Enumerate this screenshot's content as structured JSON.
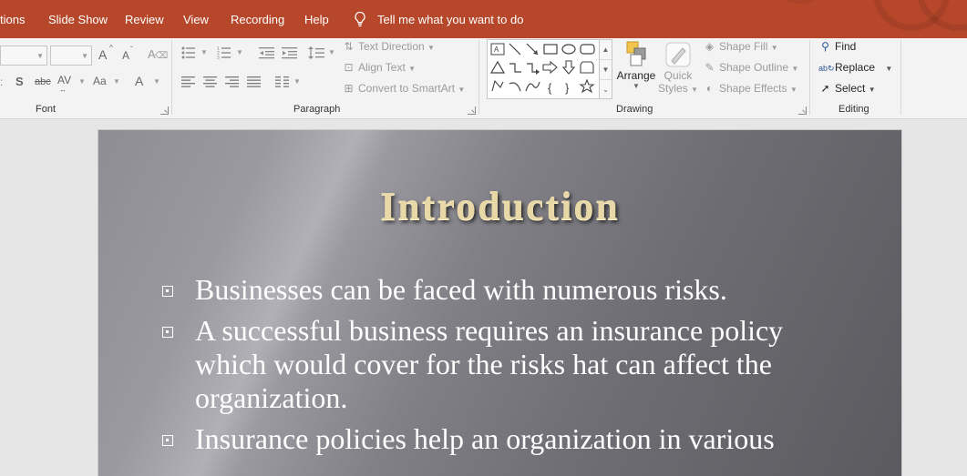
{
  "tabs": [
    {
      "label": "tions"
    },
    {
      "label": "Slide Show"
    },
    {
      "label": "Review"
    },
    {
      "label": "View"
    },
    {
      "label": "Recording"
    },
    {
      "label": "Help"
    }
  ],
  "tell_me": {
    "placeholder": "Tell me what you want to do",
    "icon": "lightbulb-icon"
  },
  "ribbon": {
    "font": {
      "label": "Font",
      "grow_glyph": "A",
      "shrink_glyph": "A",
      "clear_glyph": "A",
      "shadow_glyph": "S",
      "strike_glyph": "abc",
      "spacing_glyph": "AV",
      "case_glyph": "Aa",
      "color_glyph": "A"
    },
    "paragraph": {
      "label": "Paragraph",
      "text_direction": "Text Direction",
      "align_text": "Align Text",
      "convert_smartart": "Convert to SmartArt"
    },
    "drawing": {
      "label": "Drawing",
      "arrange": "Arrange",
      "quick_styles_line1": "Quick",
      "quick_styles_line2": "Styles",
      "shape_fill": "Shape Fill",
      "shape_outline": "Shape Outline",
      "shape_effects": "Shape Effects",
      "gallery_text_glyph": "A",
      "gallery_brace_open": "{",
      "gallery_brace_close": "}"
    },
    "editing": {
      "label": "Editing",
      "find": "Find",
      "replace": "Replace",
      "select": "Select"
    }
  },
  "slide": {
    "title": "Introduction",
    "bullets": [
      {
        "text": "Businesses can be faced with numerous risks."
      },
      {
        "text": "A successful business requires an insurance policy which would cover for the risks hat can affect the organization."
      },
      {
        "text": "Insurance policies help an organization in various"
      }
    ]
  },
  "colors": {
    "ribbon_accent": "#b7472a",
    "title_gold": "#e8d8a8"
  }
}
